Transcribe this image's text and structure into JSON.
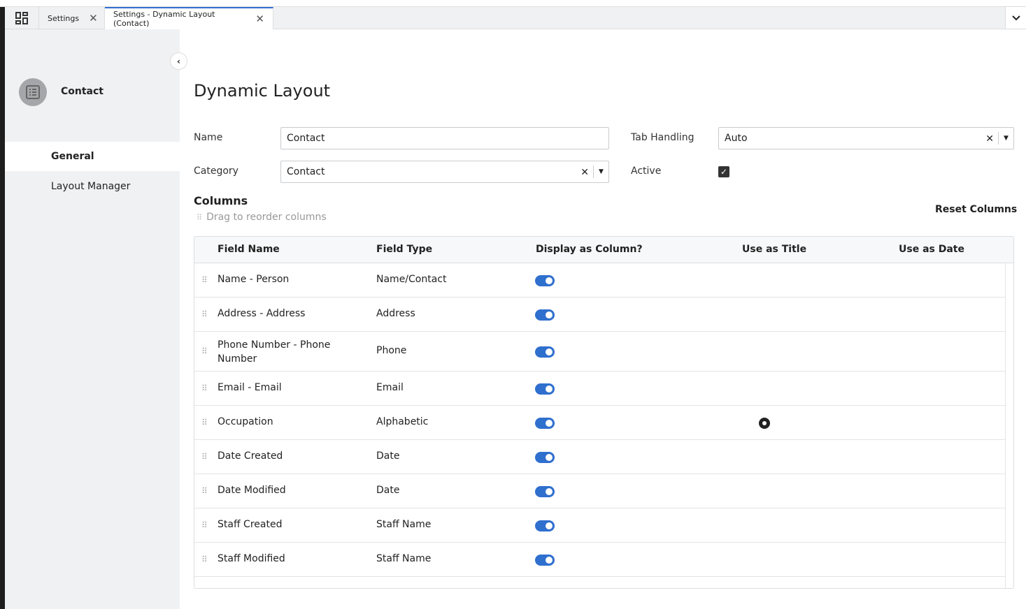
{
  "tabs": [
    {
      "label": "Settings"
    },
    {
      "label": "Settings - Dynamic Layout (Contact)",
      "active": true
    }
  ],
  "sidebar": {
    "title": "Contact",
    "items": [
      {
        "label": "General",
        "selected": true
      },
      {
        "label": "Layout Manager"
      }
    ]
  },
  "main": {
    "title": "Dynamic Layout",
    "form": {
      "name_label": "Name",
      "name_value": "Contact",
      "category_label": "Category",
      "category_value": "Contact",
      "tab_label": "Tab Handling",
      "tab_value": "Auto",
      "active_label": "Active",
      "active_checked": true
    },
    "columns_title": "Columns",
    "drag_hint": "Drag to reorder columns",
    "reset_label": "Reset Columns",
    "headers": [
      "Field Name",
      "Field Type",
      "Display as Column?",
      "Use as Title",
      "Use as Date"
    ],
    "rows": [
      {
        "name": "Name - Person",
        "type": "Name/Contact",
        "display": true,
        "title": false
      },
      {
        "name": "Address - Address",
        "type": "Address",
        "display": true,
        "title": false
      },
      {
        "name": "Phone Number - Phone Number",
        "type": "Phone",
        "display": true,
        "title": false
      },
      {
        "name": "Email - Email",
        "type": "Email",
        "display": true,
        "title": false
      },
      {
        "name": "Occupation",
        "type": "Alphabetic",
        "display": true,
        "title": true
      },
      {
        "name": "Date Created",
        "type": "Date",
        "display": true,
        "title": false
      },
      {
        "name": "Date Modified",
        "type": "Date",
        "display": true,
        "title": false
      },
      {
        "name": "Staff Created",
        "type": "Staff Name",
        "display": true,
        "title": false
      },
      {
        "name": "Staff Modified",
        "type": "Staff Name",
        "display": true,
        "title": false
      }
    ]
  },
  "colors": {
    "accent": "#2f6fce",
    "sidebar_bg": "#f0f1f3"
  }
}
